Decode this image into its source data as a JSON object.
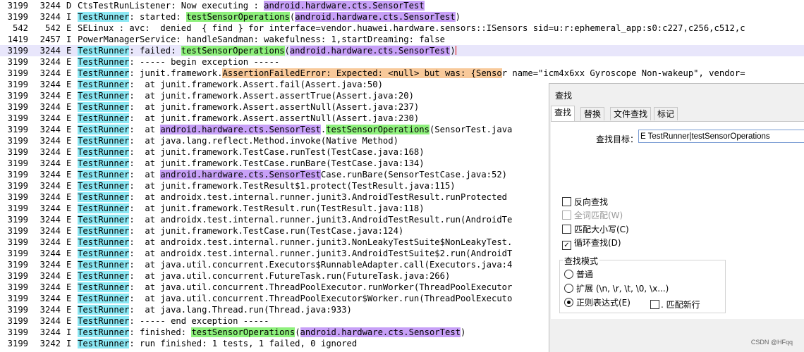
{
  "log": [
    {
      "pid": "3199",
      "tid": "3244",
      "level": "D",
      "segments": [
        {
          "t": "CtsTestRunListener: Now executing : "
        },
        {
          "t": "android.hardware.cts.SensorTest",
          "h": "class"
        }
      ]
    },
    {
      "pid": "3199",
      "tid": "3244",
      "level": "I",
      "segments": [
        {
          "t": "TestRunner",
          "h": "tag"
        },
        {
          "t": ": started: "
        },
        {
          "t": "testSensorOperations",
          "h": "method"
        },
        {
          "t": "("
        },
        {
          "t": "android.hardware.cts.SensorTest",
          "h": "class"
        },
        {
          "t": ")"
        }
      ]
    },
    {
      "pid": "542",
      "tid": "542",
      "level": "E",
      "segments": [
        {
          "t": "SELinux : avc:  denied  { find } for interface=vendor.huawei.hardware.sensors::ISensors sid=u:r:ephemeral_app:s0:c227,c256,c512,c"
        }
      ]
    },
    {
      "pid": "1419",
      "tid": "2457",
      "level": "I",
      "segments": [
        {
          "t": "PowerManagerService: handleSandman: wakefulness: 1,startDreaming: false"
        }
      ]
    },
    {
      "pid": "3199",
      "tid": "3244",
      "level": "E",
      "selected": true,
      "segments": [
        {
          "t": "TestRunner",
          "h": "tag"
        },
        {
          "t": ": failed: "
        },
        {
          "t": "testSensorOperations",
          "h": "method"
        },
        {
          "t": "("
        },
        {
          "t": "android.hardware.cts.SensorTest",
          "h": "class"
        },
        {
          "t": ")"
        },
        {
          "t": "",
          "h": "caret"
        }
      ]
    },
    {
      "pid": "3199",
      "tid": "3244",
      "level": "E",
      "segments": [
        {
          "t": "TestRunner",
          "h": "tag"
        },
        {
          "t": ": ----- begin exception -----"
        }
      ]
    },
    {
      "pid": "3199",
      "tid": "3244",
      "level": "E",
      "segments": [
        {
          "t": "TestRunner",
          "h": "tag"
        },
        {
          "t": ": junit.framework."
        },
        {
          "t": "AssertionFailedError: Expected: <null> but was: {Senso",
          "h": "err"
        },
        {
          "t": "r name=\"icm4x6xx Gyroscope Non-wakeup\", vendor="
        }
      ]
    },
    {
      "pid": "3199",
      "tid": "3244",
      "level": "E",
      "segments": [
        {
          "t": "TestRunner",
          "h": "tag"
        },
        {
          "t": ":  at junit.framework.Assert.fail(Assert.java:50)"
        }
      ]
    },
    {
      "pid": "3199",
      "tid": "3244",
      "level": "E",
      "segments": [
        {
          "t": "TestRunner",
          "h": "tag"
        },
        {
          "t": ":  at junit.framework.Assert.assertTrue(Assert.java:20)"
        }
      ]
    },
    {
      "pid": "3199",
      "tid": "3244",
      "level": "E",
      "segments": [
        {
          "t": "TestRunner",
          "h": "tag"
        },
        {
          "t": ":  at junit.framework.Assert.assertNull(Assert.java:237)"
        }
      ]
    },
    {
      "pid": "3199",
      "tid": "3244",
      "level": "E",
      "segments": [
        {
          "t": "TestRunner",
          "h": "tag"
        },
        {
          "t": ":  at junit.framework.Assert.assertNull(Assert.java:230)"
        }
      ]
    },
    {
      "pid": "3199",
      "tid": "3244",
      "level": "E",
      "segments": [
        {
          "t": "TestRunner",
          "h": "tag"
        },
        {
          "t": ":  at "
        },
        {
          "t": "android.hardware.cts.SensorTest",
          "h": "class"
        },
        {
          "t": "."
        },
        {
          "t": "testSensorOperations",
          "h": "method"
        },
        {
          "t": "(SensorTest.java"
        }
      ]
    },
    {
      "pid": "3199",
      "tid": "3244",
      "level": "E",
      "segments": [
        {
          "t": "TestRunner",
          "h": "tag"
        },
        {
          "t": ":  at java.lang.reflect.Method.invoke(Native Method)"
        }
      ]
    },
    {
      "pid": "3199",
      "tid": "3244",
      "level": "E",
      "segments": [
        {
          "t": "TestRunner",
          "h": "tag"
        },
        {
          "t": ":  at junit.framework.TestCase.runTest(TestCase.java:168)"
        }
      ]
    },
    {
      "pid": "3199",
      "tid": "3244",
      "level": "E",
      "segments": [
        {
          "t": "TestRunner",
          "h": "tag"
        },
        {
          "t": ":  at junit.framework.TestCase.runBare(TestCase.java:134)"
        }
      ]
    },
    {
      "pid": "3199",
      "tid": "3244",
      "level": "E",
      "segments": [
        {
          "t": "TestRunner",
          "h": "tag"
        },
        {
          "t": ":  at "
        },
        {
          "t": "android.hardware.cts.SensorTest",
          "h": "class"
        },
        {
          "t": "Case.runBare(SensorTestCase.java:52)"
        }
      ]
    },
    {
      "pid": "3199",
      "tid": "3244",
      "level": "E",
      "segments": [
        {
          "t": "TestRunner",
          "h": "tag"
        },
        {
          "t": ":  at junit.framework.TestResult$1.protect(TestResult.java:115)"
        }
      ]
    },
    {
      "pid": "3199",
      "tid": "3244",
      "level": "E",
      "segments": [
        {
          "t": "TestRunner",
          "h": "tag"
        },
        {
          "t": ":  at androidx.test.internal.runner.junit3.AndroidTestResult.runProtected"
        }
      ]
    },
    {
      "pid": "3199",
      "tid": "3244",
      "level": "E",
      "segments": [
        {
          "t": "TestRunner",
          "h": "tag"
        },
        {
          "t": ":  at junit.framework.TestResult.run(TestResult.java:118)"
        }
      ]
    },
    {
      "pid": "3199",
      "tid": "3244",
      "level": "E",
      "segments": [
        {
          "t": "TestRunner",
          "h": "tag"
        },
        {
          "t": ":  at androidx.test.internal.runner.junit3.AndroidTestResult.run(AndroidTe"
        }
      ]
    },
    {
      "pid": "3199",
      "tid": "3244",
      "level": "E",
      "segments": [
        {
          "t": "TestRunner",
          "h": "tag"
        },
        {
          "t": ":  at junit.framework.TestCase.run(TestCase.java:124)"
        }
      ]
    },
    {
      "pid": "3199",
      "tid": "3244",
      "level": "E",
      "segments": [
        {
          "t": "TestRunner",
          "h": "tag"
        },
        {
          "t": ":  at androidx.test.internal.runner.junit3.NonLeakyTestSuite$NonLeakyTest."
        }
      ]
    },
    {
      "pid": "3199",
      "tid": "3244",
      "level": "E",
      "segments": [
        {
          "t": "TestRunner",
          "h": "tag"
        },
        {
          "t": ":  at androidx.test.internal.runner.junit3.AndroidTestSuite$2.run(AndroidT"
        }
      ]
    },
    {
      "pid": "3199",
      "tid": "3244",
      "level": "E",
      "segments": [
        {
          "t": "TestRunner",
          "h": "tag"
        },
        {
          "t": ":  at java.util.concurrent.Executors$RunnableAdapter.call(Executors.java:4"
        }
      ]
    },
    {
      "pid": "3199",
      "tid": "3244",
      "level": "E",
      "segments": [
        {
          "t": "TestRunner",
          "h": "tag"
        },
        {
          "t": ":  at java.util.concurrent.FutureTask.run(FutureTask.java:266)"
        }
      ]
    },
    {
      "pid": "3199",
      "tid": "3244",
      "level": "E",
      "segments": [
        {
          "t": "TestRunner",
          "h": "tag"
        },
        {
          "t": ":  at java.util.concurrent.ThreadPoolExecutor.runWorker(ThreadPoolExecutor"
        }
      ]
    },
    {
      "pid": "3199",
      "tid": "3244",
      "level": "E",
      "segments": [
        {
          "t": "TestRunner",
          "h": "tag"
        },
        {
          "t": ":  at java.util.concurrent.ThreadPoolExecutor$Worker.run(ThreadPoolExecuto"
        }
      ]
    },
    {
      "pid": "3199",
      "tid": "3244",
      "level": "E",
      "segments": [
        {
          "t": "TestRunner",
          "h": "tag"
        },
        {
          "t": ":  at java.lang.Thread.run(Thread.java:933)"
        }
      ]
    },
    {
      "pid": "3199",
      "tid": "3244",
      "level": "E",
      "segments": [
        {
          "t": "TestRunner",
          "h": "tag"
        },
        {
          "t": ": ----- end exception -----"
        }
      ]
    },
    {
      "pid": "3199",
      "tid": "3244",
      "level": "I",
      "segments": [
        {
          "t": "TestRunner",
          "h": "tag"
        },
        {
          "t": ": finished: "
        },
        {
          "t": "testSensorOperations",
          "h": "method"
        },
        {
          "t": "("
        },
        {
          "t": "android.hardware.cts.SensorTest",
          "h": "class"
        },
        {
          "t": ")"
        }
      ]
    },
    {
      "pid": "3199",
      "tid": "3242",
      "level": "I",
      "segments": [
        {
          "t": "TestRunner",
          "h": "tag"
        },
        {
          "t": ": run finished: 1 tests, 1 failed, 0 ignored"
        }
      ]
    }
  ],
  "dialog": {
    "title": "查找",
    "tabs": [
      "查找",
      "替换",
      "文件查找",
      "标记"
    ],
    "active_tab": 0,
    "find_label": "查找目标：",
    "find_value": "E TestRunner|testSensorOperations",
    "options": [
      {
        "label": "反向查找",
        "checked": false,
        "disabled": false
      },
      {
        "label": "全词匹配(W)",
        "checked": false,
        "disabled": true
      },
      {
        "label": "匹配大小写(C)",
        "checked": false,
        "disabled": false
      },
      {
        "label": "循环查找(D)",
        "checked": true,
        "disabled": false
      }
    ],
    "mode_group_title": "查找模式",
    "modes": [
      {
        "label": "普通",
        "selected": false
      },
      {
        "label": "扩展 (\\n, \\r, \\t, \\0, \\x...)",
        "selected": false
      },
      {
        "label": "正则表达式(E)",
        "selected": true
      }
    ],
    "newline_label": ". 匹配新行",
    "newline_checked": false
  },
  "watermark": "CSDN @HFqq",
  "colors": {
    "tag": "#8ce8f4",
    "method": "#8ef07c",
    "class": "#c7a0f7",
    "error": "#f8c99a",
    "selected_row": "#e8e6fb"
  }
}
